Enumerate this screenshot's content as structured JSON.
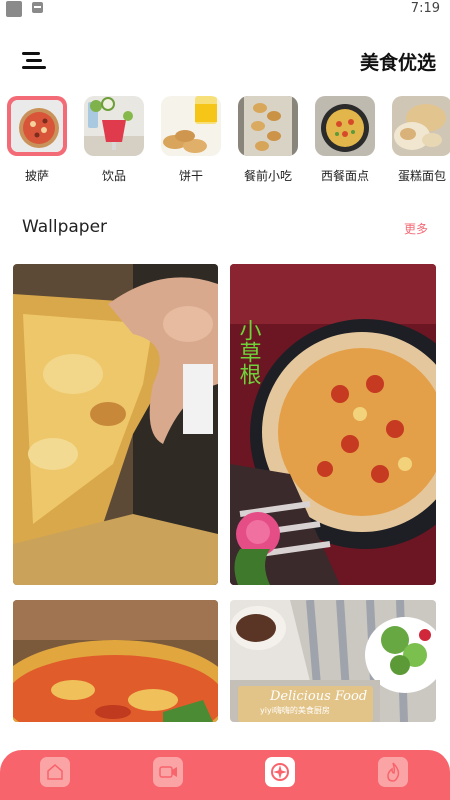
{
  "status": {
    "time": "7:19"
  },
  "header": {
    "title": "美食优选"
  },
  "categories": [
    {
      "label": "披萨",
      "icon": "pizza-thumbnail",
      "active": true
    },
    {
      "label": "饮品",
      "icon": "drinks-thumbnail"
    },
    {
      "label": "饼干",
      "icon": "cookies-thumbnail"
    },
    {
      "label": "餐前小吃",
      "icon": "appetizer-thumbnail"
    },
    {
      "label": "西餐面点",
      "icon": "western-pastry-thumbnail"
    },
    {
      "label": "蛋糕面包",
      "icon": "cake-bread-thumbnail"
    }
  ],
  "section": {
    "title": "Wallpaper",
    "more": "更多"
  },
  "wallpapers": [
    {
      "caption": ""
    },
    {
      "caption": "小草根"
    },
    {
      "caption": ""
    },
    {
      "caption": "Delicious Food",
      "subcaption": "yiyi嗨嗨的美食厨房"
    }
  ],
  "nav": [
    {
      "icon": "home-icon"
    },
    {
      "icon": "video-icon"
    },
    {
      "icon": "discover-icon",
      "active": true
    },
    {
      "icon": "hot-icon"
    }
  ],
  "colors": {
    "accent": "#f8646b",
    "more": "#f36b76"
  }
}
